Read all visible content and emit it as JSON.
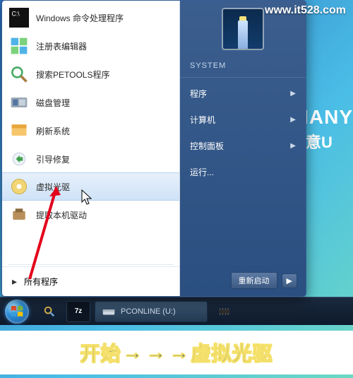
{
  "watermark": "www.it528.com",
  "brand": {
    "line1": "TIANY",
    "line2": "天意U"
  },
  "startmenu": {
    "items": [
      {
        "label": "Windows 命令处理程序",
        "icon": "cmd-icon"
      },
      {
        "label": "注册表编辑器",
        "icon": "regedit-icon"
      },
      {
        "label": "搜索PETOOLS程序",
        "icon": "search-icon"
      },
      {
        "label": "磁盘管理",
        "icon": "disk-mgmt-icon"
      },
      {
        "label": "刷新系统",
        "icon": "refresh-icon"
      },
      {
        "label": "引导修复",
        "icon": "boot-repair-icon"
      },
      {
        "label": "虚拟光驱",
        "icon": "virtual-drive-icon"
      },
      {
        "label": "提取本机驱动",
        "icon": "extract-driver-icon"
      }
    ],
    "all_programs": "所有程序",
    "right": {
      "system_label": "SYSTEM",
      "items": [
        {
          "label": "程序"
        },
        {
          "label": "计算机"
        },
        {
          "label": "控制面板"
        },
        {
          "label": "运行..."
        }
      ],
      "restart": "重新启动"
    }
  },
  "taskbar": {
    "zip_label": "7z",
    "drive_label": "PCONLINE  (U:)"
  },
  "caption": {
    "part1": "开始",
    "part2": "虚拟光驱"
  }
}
